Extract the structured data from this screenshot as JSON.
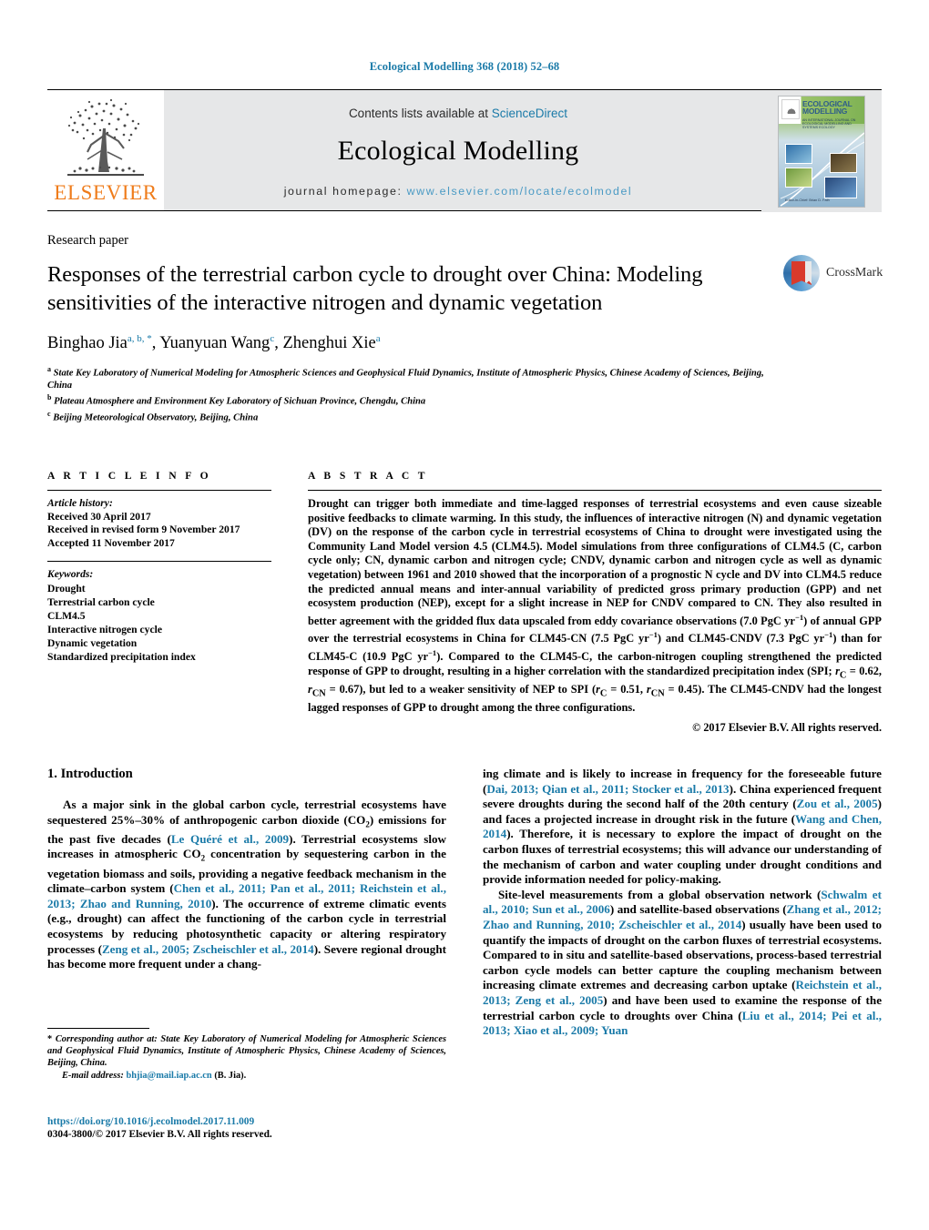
{
  "running_head": "Ecological Modelling 368 (2018) 52–68",
  "masthead": {
    "publisher_name": "ELSEVIER",
    "contents_prefix": "Contents lists available at ",
    "contents_link": "ScienceDirect",
    "journal_title": "Ecological Modelling",
    "homepage_prefix": "journal homepage:",
    "homepage_url": "www.elsevier.com/locate/ecolmodel",
    "cover": {
      "title": "ECOLOGICAL MODELLING",
      "subtitle": "AN INTERNATIONAL JOURNAL ON ECOLOGICAL MODELLING AND SYSTEMS ECOLOGY",
      "editors": "Editor-in-Chief: Brian D. Fath"
    }
  },
  "article": {
    "type_label": "Research paper",
    "title": "Responses of the terrestrial carbon cycle to drought over China: Modeling sensitivities of the interactive nitrogen and dynamic vegetation",
    "crossmark_label": "CrossMark",
    "authors": [
      {
        "name": "Binghao Jia",
        "marks": "a, b, *"
      },
      {
        "name": "Yuanyuan Wang",
        "marks": "c"
      },
      {
        "name": "Zhenghui Xie",
        "marks": "a"
      }
    ],
    "affiliations": [
      {
        "mark": "a",
        "text": "State Key Laboratory of Numerical Modeling for Atmospheric Sciences and Geophysical Fluid Dynamics, Institute of Atmospheric Physics, Chinese Academy of Sciences, Beijing, China"
      },
      {
        "mark": "b",
        "text": "Plateau Atmosphere and Environment Key Laboratory of Sichuan Province, Chengdu, China"
      },
      {
        "mark": "c",
        "text": "Beijing Meteorological Observatory, Beijing, China"
      }
    ]
  },
  "article_info": {
    "heading": "A R T I C L E   I N F O",
    "history_label": "Article history:",
    "history": [
      "Received 30 April 2017",
      "Received in revised form 9 November 2017",
      "Accepted 11 November 2017"
    ],
    "keywords_label": "Keywords:",
    "keywords": [
      "Drought",
      "Terrestrial carbon cycle",
      "CLM4.5",
      "Interactive nitrogen cycle",
      "Dynamic vegetation",
      "Standardized precipitation index"
    ]
  },
  "abstract": {
    "heading": "A B S T R A C T",
    "text_html": "Drought can trigger both immediate and time-lagged responses of terrestrial ecosystems and even cause sizeable positive feedbacks to climate warming. In this study, the influences of interactive nitrogen (N) and dynamic vegetation (DV) on the response of the carbon cycle in terrestrial ecosystems of China to drought were investigated using the Community Land Model version 4.5 (CLM4.5). Model simulations from three configurations of CLM4.5 (C, carbon cycle only; CN, dynamic carbon and nitrogen cycle; CNDV, dynamic carbon and nitrogen cycle as well as dynamic vegetation) between 1961 and 2010 showed that the incorporation of a prognostic N cycle and DV into CLM4.5 reduce the predicted annual means and inter-annual variability of predicted gross primary production (GPP) and net ecosystem production (NEP), except for a slight increase in NEP for CNDV compared to CN. They also resulted in better agreement with the gridded flux data upscaled from eddy covariance observations (7.0 PgC yr<sup>−1</sup>) of annual GPP over the terrestrial ecosystems in China for CLM45-CN (7.5 PgC yr<sup>−1</sup>) and CLM45-CNDV (7.3 PgC yr<sup>−1</sup>) than for CLM45-C (10.9 PgC yr<sup>−1</sup>). Compared to the CLM45-C, the carbon-nitrogen coupling strengthened the predicted response of GPP to drought, resulting in a higher correlation with the standardized precipitation index (SPI; <i>r</i><sub>C</sub> = 0.62, <i>r</i><sub>CN</sub> = 0.67), but led to a weaker sensitivity of NEP to SPI (<i>r</i><sub>C</sub> = 0.51, <i>r</i><sub>CN</sub> = 0.45). The CLM45-CNDV had the longest lagged responses of GPP to drought among the three configurations.",
    "copyright": "© 2017 Elsevier B.V. All rights reserved."
  },
  "introduction": {
    "heading": "1.  Introduction",
    "left_paragraph_html": "As a major sink in the global carbon cycle, terrestrial ecosystems have sequestered 25%–30% of anthropogenic carbon dioxide (CO<sub>2</sub>) emissions for the past five decades (<span class=\"cite\">Le Quéré et al., 2009</span>). Terrestrial ecosystems slow increases in atmospheric CO<sub>2</sub> concentration by sequestering carbon in the vegetation biomass and soils, providing a negative feedback mechanism in the climate–carbon system (<span class=\"cite\">Chen et al., 2011; Pan et al., 2011; Reichstein et al., 2013; Zhao and Running, 2010</span>). The occurrence of extreme climatic events (e.g., drought) can affect the functioning of the carbon cycle in terrestrial ecosystems by reducing photosynthetic capacity or altering respiratory processes (<span class=\"cite\">Zeng et al., 2005; Zscheischler et al., 2014</span>). Severe regional drought has become more frequent under a chang-",
    "right_paragraph_1_html": "ing climate and is likely to increase in frequency for the foreseeable future (<span class=\"cite\">Dai, 2013; Qian et al., 2011; Stocker et al., 2013</span>). China experienced frequent severe droughts during the second half of the 20th century (<span class=\"cite\">Zou et al., 2005</span>) and faces a projected increase in drought risk in the future (<span class=\"cite\">Wang and Chen, 2014</span>). Therefore, it is necessary to explore the impact of drought on the carbon fluxes of terrestrial ecosystems; this will advance our understanding of the mechanism of carbon and water coupling under drought conditions and provide information needed for policy-making.",
    "right_paragraph_2_html": "Site-level measurements from a global observation network (<span class=\"cite\">Schwalm et al., 2010; Sun et al., 2006</span>) and satellite-based observations (<span class=\"cite\">Zhang et al., 2012; Zhao and Running, 2010; Zscheischler et al., 2014</span>) usually have been used to quantify the impacts of drought on the carbon fluxes of terrestrial ecosystems. Compared to in situ and satellite-based observations, process-based terrestrial carbon cycle models can better capture the coupling mechanism between increasing climate extremes and decreasing carbon uptake (<span class=\"cite\">Reichstein et al., 2013; Zeng et al., 2005</span>) and have been used to examine the response of the terrestrial carbon cycle to droughts over China (<span class=\"cite\">Liu et al., 2014; Pei et al., 2013; Xiao et al., 2009; Yuan</span>"
  },
  "footer": {
    "corresponding_html": "<span class=\"nonit\">*</span> Corresponding author at: State Key Laboratory of Numerical Modeling for Atmospheric Sciences and Geophysical Fluid Dynamics, Institute of Atmospheric Physics, Chinese Academy of Sciences, Beijing, China.",
    "email_label": "E-mail address:",
    "email": "bhjia@mail.iap.ac.cn",
    "email_suffix": "(B. Jia).",
    "doi": "https://doi.org/10.1016/j.ecolmodel.2017.11.009",
    "issn_line": "0304-3800/© 2017 Elsevier B.V. All rights reserved."
  },
  "colors": {
    "link_blue": "#1a7aa8",
    "elsevier_orange": "#ef7c1b",
    "band_grey": "#e6e7e8"
  }
}
